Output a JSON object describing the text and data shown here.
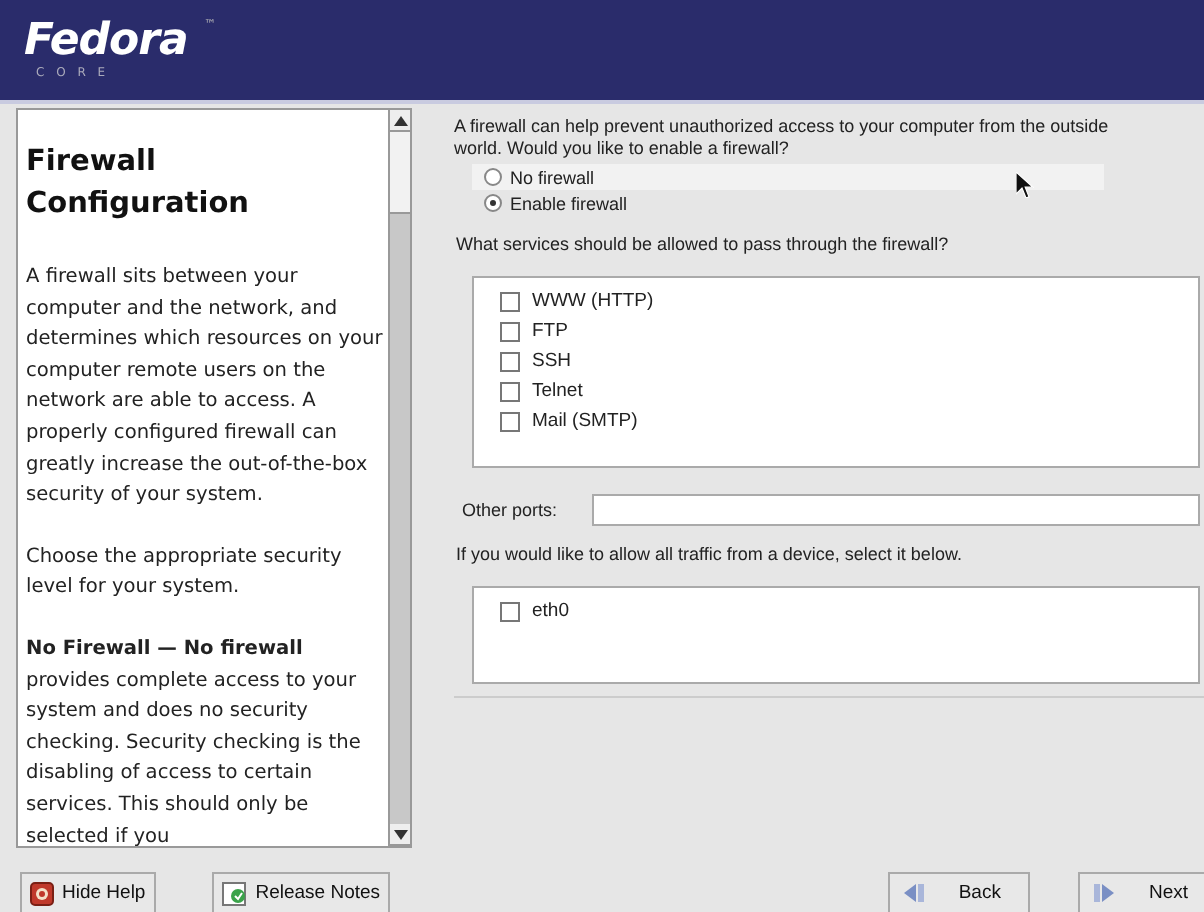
{
  "banner": {
    "logo": "Fedora",
    "tm": "™",
    "subtitle": "C O R E"
  },
  "help": {
    "title": "Firewall Configuration",
    "paragraphs": [
      "A firewall sits between your computer and the network, and determines which resources on your computer remote users on the network are able to access. A properly configured firewall can greatly increase the out-of-the-box security of your system.",
      "Choose the appropriate security level for your system.",
      "**No Firewall — No firewall** provides complete access to your system and does no security checking. Security checking is the disabling of access to certain services. This should only be selected if you"
    ]
  },
  "intro": "A firewall can help prevent unauthorized access to your computer from the outside world.  Would you like to enable a firewall?",
  "firewall_options": [
    {
      "label": "No firewall",
      "selected": false,
      "highlighted": true
    },
    {
      "label": "Enable firewall",
      "selected": true,
      "highlighted": false
    }
  ],
  "services_prompt": "What services should be allowed to pass through the firewall?",
  "services": [
    {
      "label": "WWW (HTTP)",
      "checked": false
    },
    {
      "label": "FTP",
      "checked": false
    },
    {
      "label": "SSH",
      "checked": false
    },
    {
      "label": "Telnet",
      "checked": false
    },
    {
      "label": "Mail (SMTP)",
      "checked": false
    }
  ],
  "other_ports": {
    "label": "Other ports:"
  },
  "devices_prompt": "If you would like to allow all traffic from a device, select it below.",
  "devices": [
    {
      "label": "eth0",
      "checked": false
    }
  ],
  "buttons": [
    {
      "kind": "help",
      "label": "Hide Help"
    },
    {
      "kind": "notes",
      "label": "Release Notes"
    },
    {
      "kind": "back",
      "label": "Back"
    },
    {
      "kind": "next",
      "label": "Next"
    }
  ]
}
